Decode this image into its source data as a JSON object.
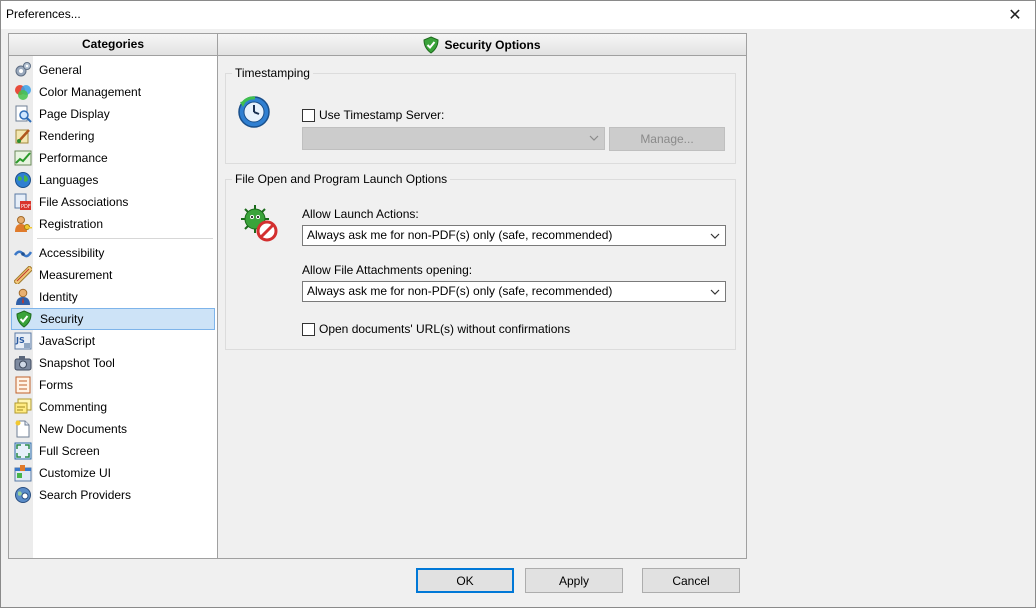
{
  "window": {
    "title": "Preferences...",
    "close_glyph": "✕"
  },
  "categories": {
    "header": "Categories",
    "group1": [
      {
        "label": "General",
        "icon": "gears-icon"
      },
      {
        "label": "Color Management",
        "icon": "color-circles-icon"
      },
      {
        "label": "Page Display",
        "icon": "page-magnifier-icon"
      },
      {
        "label": "Rendering",
        "icon": "paintbrush-icon"
      },
      {
        "label": "Performance",
        "icon": "chart-icon"
      },
      {
        "label": "Languages",
        "icon": "globe-icon"
      },
      {
        "label": "File Associations",
        "icon": "file-associations-icon"
      },
      {
        "label": "Registration",
        "icon": "user-key-icon"
      }
    ],
    "group2": [
      {
        "label": "Accessibility",
        "icon": "accessibility-icon"
      },
      {
        "label": "Measurement",
        "icon": "ruler-icon"
      },
      {
        "label": "Identity",
        "icon": "identity-icon"
      },
      {
        "label": "Security",
        "icon": "shield-icon",
        "selected": true
      },
      {
        "label": "JavaScript",
        "icon": "javascript-icon"
      },
      {
        "label": "Snapshot Tool",
        "icon": "camera-icon"
      },
      {
        "label": "Forms",
        "icon": "form-icon"
      },
      {
        "label": "Commenting",
        "icon": "comment-icon"
      },
      {
        "label": "New Documents",
        "icon": "new-document-icon"
      },
      {
        "label": "Full Screen",
        "icon": "fullscreen-icon"
      },
      {
        "label": "Customize UI",
        "icon": "customize-icon"
      },
      {
        "label": "Search Providers",
        "icon": "search-globe-icon"
      }
    ]
  },
  "security": {
    "header": "Security Options",
    "timestamping": {
      "group_label": "Timestamping",
      "use_server_label": "Use Timestamp Server:",
      "use_server_checked": false,
      "server_value": "",
      "manage_label": "Manage..."
    },
    "launch": {
      "group_label": "File Open and Program Launch Options",
      "launch_actions_label": "Allow Launch Actions:",
      "launch_actions_value": "Always ask me for non-PDF(s) only (safe, recommended)",
      "attachments_label": "Allow File Attachments opening:",
      "attachments_value": "Always ask me for non-PDF(s) only (safe, recommended)",
      "open_urls_label": "Open documents' URL(s) without confirmations",
      "open_urls_checked": false
    }
  },
  "footer": {
    "ok_label": "OK",
    "apply_label": "Apply",
    "cancel_label": "Cancel"
  },
  "colors": {
    "accent": "#0078d7",
    "selection_bg": "#cde3f7",
    "selection_border": "#7eb4ea"
  }
}
